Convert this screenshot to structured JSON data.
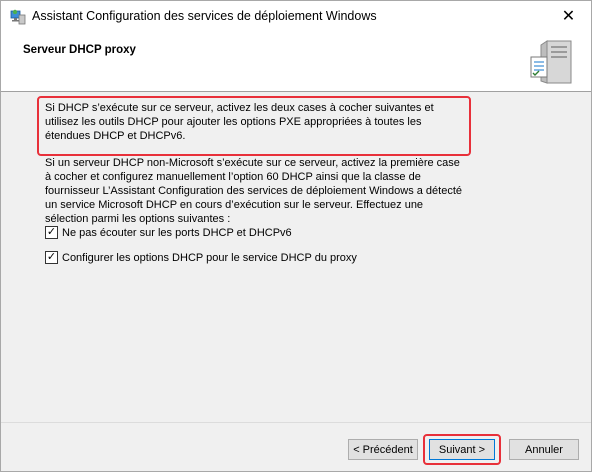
{
  "window": {
    "title": "Assistant Configuration des services de déploiement Windows",
    "close_glyph": "✕"
  },
  "header": {
    "title": "Serveur DHCP proxy"
  },
  "content": {
    "highlighted_text": "Si DHCP s’exécute sur ce serveur, activez les deux cases à cocher suivantes et utilisez les outils DHCP pour ajouter les options PXE appropriées à toutes les étendues DHCP et DHCPv6.",
    "info_text": "Si un serveur DHCP non-Microsoft s’exécute sur ce serveur, activez la première case à cocher et configurez manuellement l’option 60 DHCP ainsi que la classe de fournisseur L’Assistant Configuration des services de déploiement Windows a détecté un service Microsoft DHCP en cours d’exécution sur le serveur. Effectuez une sélection parmi les options suivantes :",
    "checkboxes": [
      {
        "label": "Ne pas écouter sur les ports DHCP et DHCPv6",
        "checked": true
      },
      {
        "label": "Configurer les options DHCP pour le service DHCP du proxy",
        "checked": true
      }
    ],
    "check_glyph": "✓"
  },
  "footer": {
    "prev_label": "< Précédent",
    "next_label": "Suivant >",
    "cancel_label": "Annuler"
  },
  "colors": {
    "highlight": "#e8303a",
    "accent": "#0078d7"
  }
}
